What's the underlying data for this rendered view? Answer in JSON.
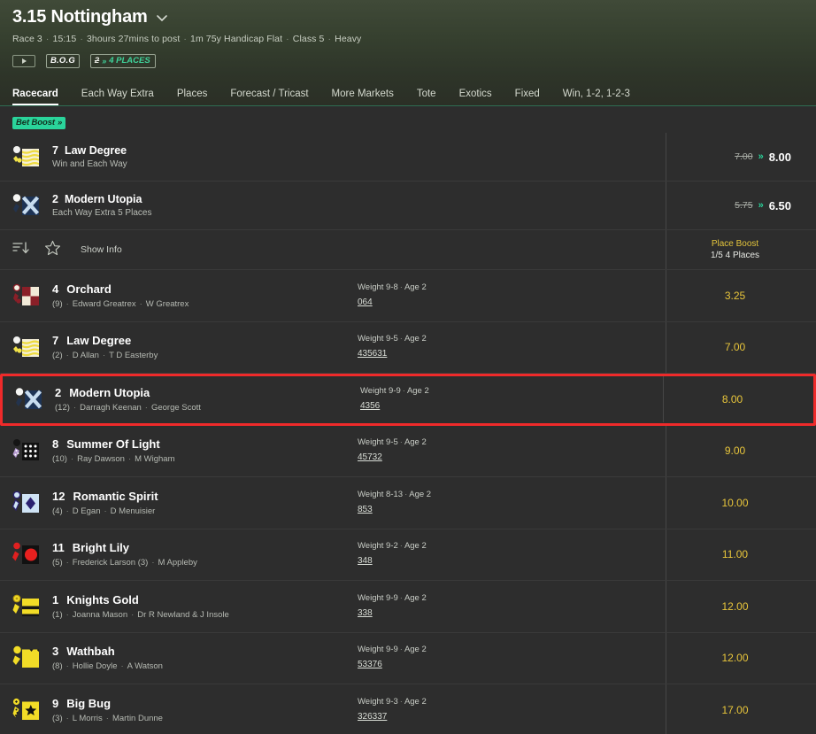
{
  "header": {
    "title": "3.15 Nottingham",
    "subtitle_parts": [
      "Race 3",
      "15:15",
      "3hours 27mins to post",
      "1m 75y Handicap Flat",
      "Class 5",
      "Heavy"
    ],
    "bog_label": "B.O.G",
    "places_old": "2",
    "places_arrows": "»",
    "places_new": "4 PLACES",
    "play_icon": "play-icon",
    "chevron_icon": "chevron-down-icon"
  },
  "tabs": [
    {
      "label": "Racecard",
      "active": true
    },
    {
      "label": "Each Way Extra",
      "active": false
    },
    {
      "label": "Places",
      "active": false
    },
    {
      "label": "Forecast / Tricast",
      "active": false
    },
    {
      "label": "More Markets",
      "active": false
    },
    {
      "label": "Tote",
      "active": false
    },
    {
      "label": "Exotics",
      "active": false
    },
    {
      "label": "Fixed",
      "active": false
    },
    {
      "label": "Win, 1-2, 1-2-3",
      "active": false
    }
  ],
  "boost": {
    "badge_label": "Bet Boost",
    "badge_arrows": "»",
    "selections": [
      {
        "number": "7",
        "name": "Law Degree",
        "market": "Win and Each Way",
        "old_odds": "7.00",
        "arrows": "»",
        "new_odds": "8.00",
        "silk": "yellow-hoops"
      },
      {
        "number": "2",
        "name": "Modern Utopia",
        "market": "Each Way Extra 5 Places",
        "old_odds": "5.75",
        "arrows": "»",
        "new_odds": "6.50",
        "silk": "navy-cross"
      }
    ]
  },
  "sortbar": {
    "sort_icon": "sort-icon",
    "star_icon": "star-icon",
    "show_info_label": "Show Info",
    "place_boost_title": "Place Boost",
    "place_boost_sub": "1/5 4 Places"
  },
  "runners": [
    {
      "number": "4",
      "name": "Orchard",
      "draw": "(9)",
      "jockey": "Edward Greatrex",
      "trainer": "W Greatrex",
      "weight": "Weight 9-8",
      "age": "Age 2",
      "form": "064",
      "odds": "3.25",
      "silk": "maroon-check",
      "highlighted": false
    },
    {
      "number": "7",
      "name": "Law Degree",
      "draw": "(2)",
      "jockey": "D Allan",
      "trainer": "T D Easterby",
      "weight": "Weight 9-5",
      "age": "Age 2",
      "form": "435631",
      "odds": "7.00",
      "silk": "yellow-hoops",
      "highlighted": false
    },
    {
      "number": "2",
      "name": "Modern Utopia",
      "draw": "(12)",
      "jockey": "Darragh Keenan",
      "trainer": "George Scott",
      "weight": "Weight 9-9",
      "age": "Age 2",
      "form": "4356",
      "odds": "8.00",
      "silk": "navy-cross",
      "highlighted": true
    },
    {
      "number": "8",
      "name": "Summer Of Light",
      "draw": "(10)",
      "jockey": "Ray Dawson",
      "trainer": "M Wigham",
      "weight": "Weight 9-5",
      "age": "Age 2",
      "form": "45732",
      "odds": "9.00",
      "silk": "black-spots",
      "highlighted": false
    },
    {
      "number": "12",
      "name": "Romantic Spirit",
      "draw": "(4)",
      "jockey": "D Egan",
      "trainer": "D Menuisier",
      "weight": "Weight 8-13",
      "age": "Age 2",
      "form": "853",
      "odds": "10.00",
      "silk": "lightblue-diamond",
      "highlighted": false
    },
    {
      "number": "11",
      "name": "Bright Lily",
      "draw": "(5)",
      "jockey": "Frederick Larson (3)",
      "trainer": "M Appleby",
      "weight": "Weight 9-2",
      "age": "Age 2",
      "form": "348",
      "odds": "11.00",
      "silk": "black-red-disc",
      "highlighted": false
    },
    {
      "number": "1",
      "name": "Knights Gold",
      "draw": "(1)",
      "jockey": "Joanna Mason",
      "trainer": "Dr R Newland & J Insole",
      "weight": "Weight 9-9",
      "age": "Age 2",
      "form": "338",
      "odds": "12.00",
      "silk": "yellow-band",
      "highlighted": false
    },
    {
      "number": "3",
      "name": "Wathbah",
      "draw": "(8)",
      "jockey": "Hollie Doyle",
      "trainer": "A Watson",
      "weight": "Weight 9-9",
      "age": "Age 2",
      "form": "53376",
      "odds": "12.00",
      "silk": "yellow-plain",
      "highlighted": false
    },
    {
      "number": "9",
      "name": "Big Bug",
      "draw": "(3)",
      "jockey": "L Morris",
      "trainer": "Martin Dunne",
      "weight": "Weight 9-3",
      "age": "Age 2",
      "form": "326337",
      "odds": "17.00",
      "silk": "yellow-star",
      "highlighted": false
    }
  ],
  "colors": {
    "odds_yellow": "#e9c63b",
    "boost_green": "#2ad49b",
    "highlight_red": "#ef2a2a",
    "place_boost_gold": "#e3c43c",
    "page_bg": "#2d2d2d"
  }
}
